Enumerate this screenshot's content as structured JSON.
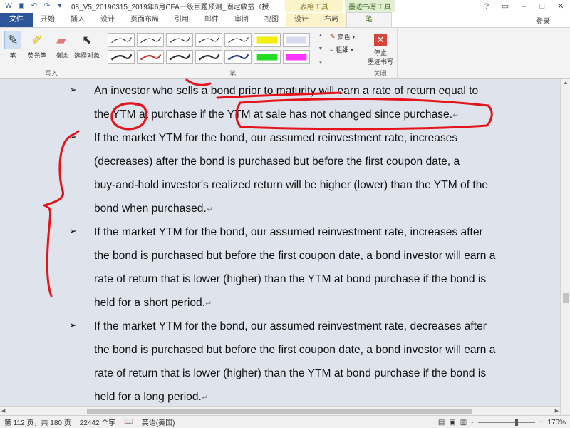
{
  "window": {
    "title": "08_V5_20190315_2019年6月CFA一级百题预测_固定收益（授...",
    "ctx_table_tools": "表格工具",
    "ctx_ink_tools": "墨迹书写工具",
    "login": "登录"
  },
  "tabs": [
    {
      "label": "文件"
    },
    {
      "label": "开始"
    },
    {
      "label": "插入"
    },
    {
      "label": "设计"
    },
    {
      "label": "页面布局"
    },
    {
      "label": "引用"
    },
    {
      "label": "邮件"
    },
    {
      "label": "审阅"
    },
    {
      "label": "视图"
    },
    {
      "label": "设计"
    },
    {
      "label": "布局"
    },
    {
      "label": "笔"
    }
  ],
  "ribbon": {
    "write_group": {
      "label": "写入",
      "pen": "笔",
      "highlighter": "荧光笔",
      "eraser": "擦除",
      "select": "选择对象"
    },
    "pens_group": {
      "label": "笔",
      "color_label": "颜色",
      "thickness_label": "粗细"
    },
    "close_group": {
      "label": "关闭",
      "stop_line1": "停止",
      "stop_line2": "墨迹书写"
    },
    "pen_colors": [
      "#2a2a2a",
      "#2a2a2a",
      "#2a2a2a",
      "#2a2a2a",
      "#2a2a2a",
      "#f0f000",
      "#d9d9f0",
      "#2a2a2a",
      "#c0392b",
      "#2a2a2a",
      "#2a2a2a",
      "#1f3a93",
      "#22dd22",
      "#ff33ff"
    ]
  },
  "document": {
    "paragraphs": [
      {
        "lines": [
          "An investor who sells a bond prior to maturity will earn a rate of return equal to",
          "the YTM at purchase if the YTM at sale has not changed since purchase."
        ]
      },
      {
        "lines": [
          "If the market YTM for the bond, our assumed reinvestment rate, increases",
          "(decreases) after the bond is purchased but before the first coupon date, a",
          "buy-and-hold investor's realized return will be higher (lower) than the YTM of the",
          "bond when purchased."
        ]
      },
      {
        "lines": [
          "If the market YTM for the bond, our assumed reinvestment rate, increases after",
          "the bond is purchased but before the first coupon date, a bond investor will earn a",
          "rate of return that is lower (higher) than the YTM at bond purchase if the bond is",
          "held for a short period."
        ]
      },
      {
        "lines": [
          "If the market YTM for the bond, our assumed reinvestment rate, decreases after",
          "the bond is purchased but before the first coupon date, a bond investor will earn a",
          "rate of return that is lower (higher) than the YTM at bond purchase if the bond is",
          "held for a long period."
        ]
      }
    ],
    "bullet_glyph": "➢",
    "ink_color": "#e3141b"
  },
  "status": {
    "page": "第 112 页，共 180 页",
    "words": "22442 个字",
    "language": "英语(美国)",
    "zoom": "170%",
    "zoom_minus": "-",
    "zoom_plus": "+"
  }
}
